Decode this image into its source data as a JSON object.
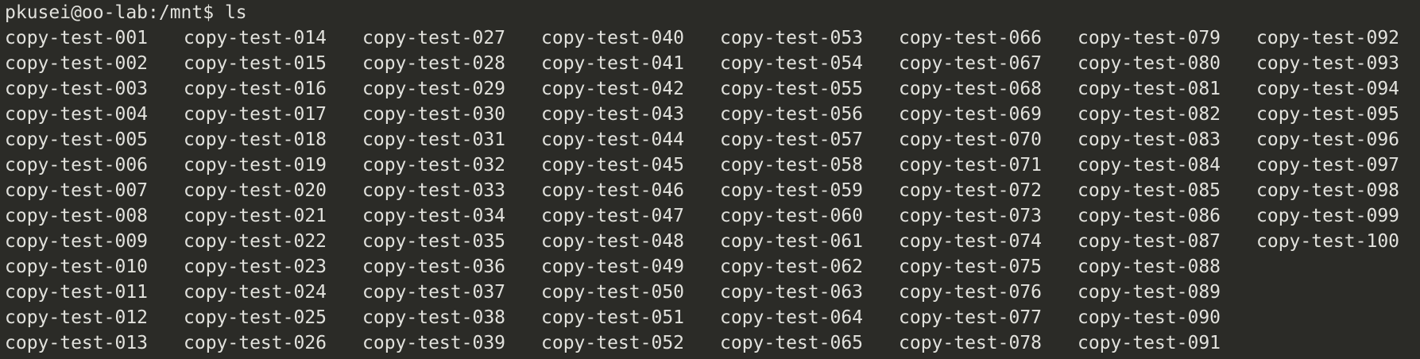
{
  "terminal": {
    "prompt": "pkusei@oo-lab:/mnt$ ",
    "command": "ls",
    "entries": [
      "copy-test-001",
      "copy-test-002",
      "copy-test-003",
      "copy-test-004",
      "copy-test-005",
      "copy-test-006",
      "copy-test-007",
      "copy-test-008",
      "copy-test-009",
      "copy-test-010",
      "copy-test-011",
      "copy-test-012",
      "copy-test-013",
      "copy-test-014",
      "copy-test-015",
      "copy-test-016",
      "copy-test-017",
      "copy-test-018",
      "copy-test-019",
      "copy-test-020",
      "copy-test-021",
      "copy-test-022",
      "copy-test-023",
      "copy-test-024",
      "copy-test-025",
      "copy-test-026",
      "copy-test-027",
      "copy-test-028",
      "copy-test-029",
      "copy-test-030",
      "copy-test-031",
      "copy-test-032",
      "copy-test-033",
      "copy-test-034",
      "copy-test-035",
      "copy-test-036",
      "copy-test-037",
      "copy-test-038",
      "copy-test-039",
      "copy-test-040",
      "copy-test-041",
      "copy-test-042",
      "copy-test-043",
      "copy-test-044",
      "copy-test-045",
      "copy-test-046",
      "copy-test-047",
      "copy-test-048",
      "copy-test-049",
      "copy-test-050",
      "copy-test-051",
      "copy-test-052",
      "copy-test-053",
      "copy-test-054",
      "copy-test-055",
      "copy-test-056",
      "copy-test-057",
      "copy-test-058",
      "copy-test-059",
      "copy-test-060",
      "copy-test-061",
      "copy-test-062",
      "copy-test-063",
      "copy-test-064",
      "copy-test-065",
      "copy-test-066",
      "copy-test-067",
      "copy-test-068",
      "copy-test-069",
      "copy-test-070",
      "copy-test-071",
      "copy-test-072",
      "copy-test-073",
      "copy-test-074",
      "copy-test-075",
      "copy-test-076",
      "copy-test-077",
      "copy-test-078",
      "copy-test-079",
      "copy-test-080",
      "copy-test-081",
      "copy-test-082",
      "copy-test-083",
      "copy-test-084",
      "copy-test-085",
      "copy-test-086",
      "copy-test-087",
      "copy-test-088",
      "copy-test-089",
      "copy-test-090",
      "copy-test-091",
      "copy-test-092",
      "copy-test-093",
      "copy-test-094",
      "copy-test-095",
      "copy-test-096",
      "copy-test-097",
      "copy-test-098",
      "copy-test-099",
      "copy-test-100"
    ],
    "colors": {
      "background": "#2b2b27",
      "foreground": "#e2e2dd"
    }
  }
}
